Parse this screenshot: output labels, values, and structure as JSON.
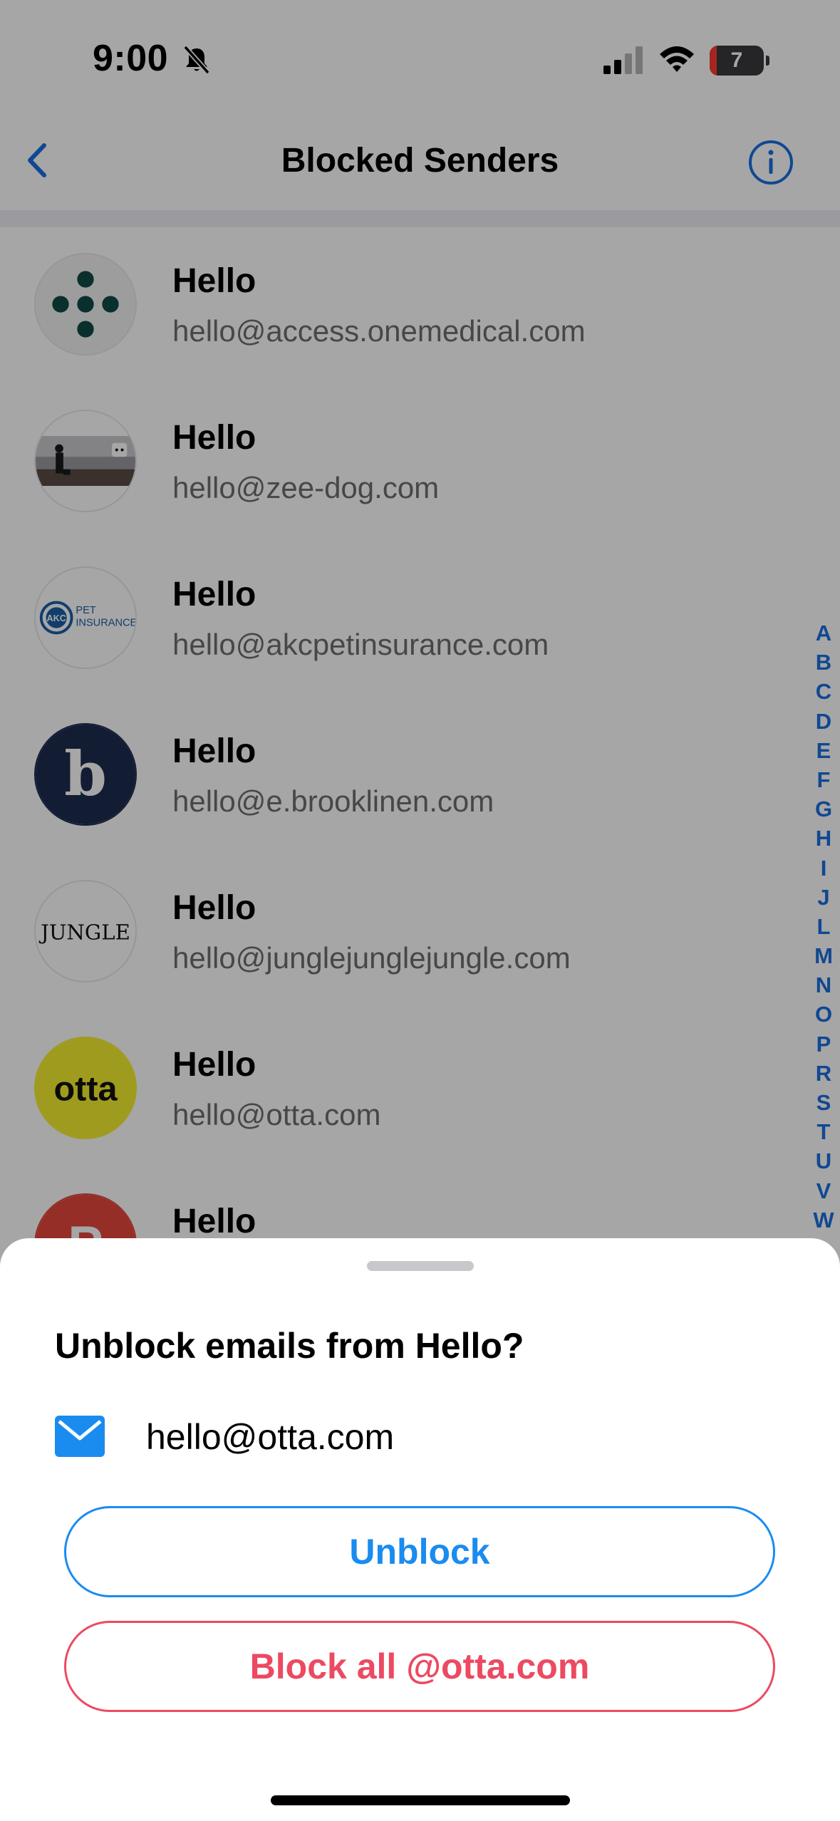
{
  "status_bar": {
    "time": "9:00",
    "battery_level": "7",
    "icons": [
      "bell-slash-icon",
      "cellular-signal-icon",
      "wifi-icon",
      "battery-icon"
    ]
  },
  "nav": {
    "title": "Blocked Senders",
    "back_icon": "chevron-left-icon",
    "info_icon": "info-circle-icon",
    "accent_color": "#1a6fe0"
  },
  "senders": [
    {
      "name": "Hello",
      "email": "hello@access.onemedical.com",
      "avatar": "onemedical-logo"
    },
    {
      "name": "Hello",
      "email": "hello@zee-dog.com",
      "avatar": "zee-dog-photo"
    },
    {
      "name": "Hello",
      "email": "hello@akcpetinsurance.com",
      "avatar": "akc-pet-insurance-logo",
      "logo_text": [
        "AKC",
        "PET",
        "INSURANCE"
      ]
    },
    {
      "name": "Hello",
      "email": "hello@e.brooklinen.com",
      "avatar": "brooklinen-logo",
      "logo_text": [
        "b"
      ]
    },
    {
      "name": "Hello",
      "email": "hello@junglejunglejungle.com",
      "avatar": "jungle-logo",
      "logo_text": [
        "JUNGLE"
      ]
    },
    {
      "name": "Hello",
      "email": "hello@otta.com",
      "avatar": "otta-logo",
      "logo_text": [
        "otta"
      ]
    },
    {
      "name": "Hello",
      "email": "",
      "avatar": "red-p-logo",
      "logo_text": [
        "P"
      ]
    }
  ],
  "alpha_index": [
    "A",
    "B",
    "C",
    "D",
    "E",
    "F",
    "G",
    "H",
    "I",
    "J",
    "L",
    "M",
    "N",
    "O",
    "P",
    "R",
    "S",
    "T",
    "U",
    "V",
    "W"
  ],
  "sheet": {
    "title": "Unblock emails from Hello?",
    "email": "hello@otta.com",
    "mail_icon": "envelope-icon",
    "unblock_label": "Unblock",
    "block_all_label": "Block all @otta.com",
    "unblock_color": "#1a8cf0",
    "block_all_color": "#ec4a61"
  }
}
